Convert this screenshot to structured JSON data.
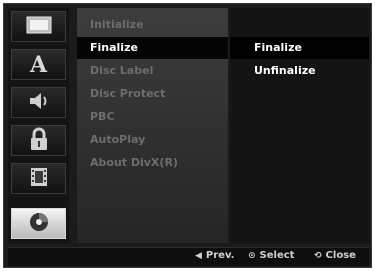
{
  "menu": {
    "items": [
      {
        "label": "Initialize",
        "selected": false
      },
      {
        "label": "Finalize",
        "selected": true
      },
      {
        "label": "Disc Label",
        "selected": false
      },
      {
        "label": "Disc Protect",
        "selected": false
      },
      {
        "label": "PBC",
        "selected": false
      },
      {
        "label": "AutoPlay",
        "selected": false
      },
      {
        "label": "About DivX(R)",
        "selected": false
      }
    ]
  },
  "options": {
    "items": [
      {
        "label": "Finalize",
        "selected": true
      },
      {
        "label": "Unfinalize",
        "selected": false
      }
    ]
  },
  "sidebar": {
    "icons": [
      {
        "name": "display-icon",
        "active": false
      },
      {
        "name": "language-icon",
        "active": false
      },
      {
        "name": "audio-icon",
        "active": false
      },
      {
        "name": "lock-icon",
        "active": false
      },
      {
        "name": "film-icon",
        "active": false
      },
      {
        "name": "disc-icon",
        "active": true
      }
    ],
    "language_glyph": "A"
  },
  "footer": {
    "prev_label": "Prev.",
    "select_label": "Select",
    "close_label": "Close"
  },
  "colors": {
    "background": "#1b1b1b",
    "menu_text_dim": "#6d6d6d",
    "highlight_text": "#ffffff"
  }
}
